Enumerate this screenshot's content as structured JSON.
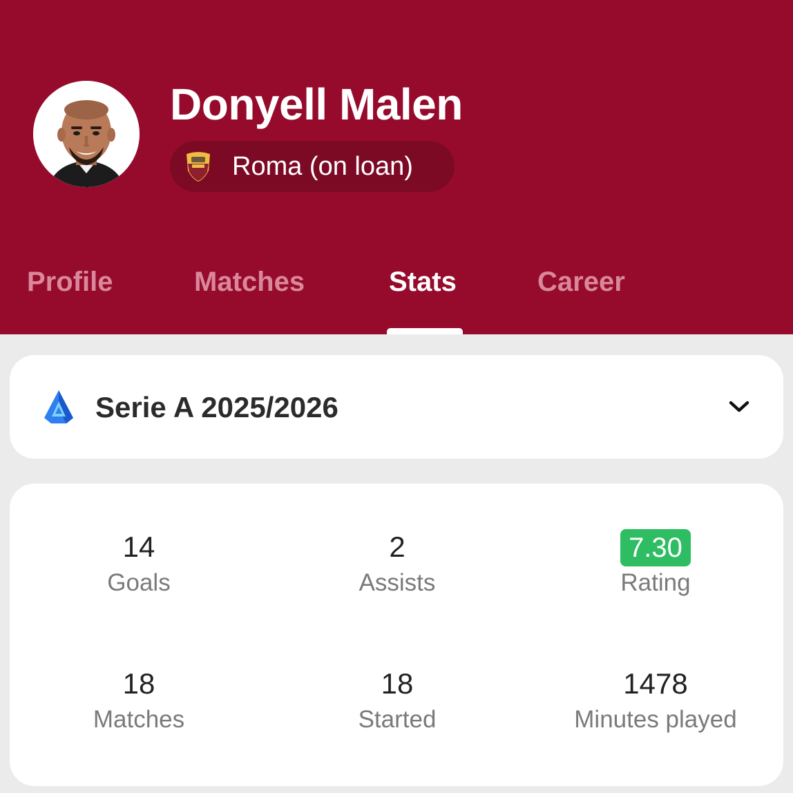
{
  "player": {
    "name": "Donyell Malen",
    "avatar_icon": "player-photo",
    "team": "Roma (on loan)",
    "team_icon": "roma-crest-icon"
  },
  "tabs": [
    {
      "label": "Profile",
      "active": false
    },
    {
      "label": "Matches",
      "active": false
    },
    {
      "label": "Stats",
      "active": true
    },
    {
      "label": "Career",
      "active": false
    }
  ],
  "league": {
    "name": "Serie A 2025/2026",
    "icon": "serie-a-icon",
    "dropdown_icon": "chevron-down-icon"
  },
  "stats": [
    {
      "value": "14",
      "label": "Goals"
    },
    {
      "value": "2",
      "label": "Assists"
    },
    {
      "value": "7.30",
      "label": "Rating",
      "badge_color": "#2ebd62"
    },
    {
      "value": "18",
      "label": "Matches"
    },
    {
      "value": "18",
      "label": "Started"
    },
    {
      "value": "1478",
      "label": "Minutes played"
    }
  ],
  "colors": {
    "header": "#960b2c",
    "team_chip": "#7c0a25",
    "inactive_tab": "#d9889b",
    "rating_badge": "#2ebd62"
  }
}
